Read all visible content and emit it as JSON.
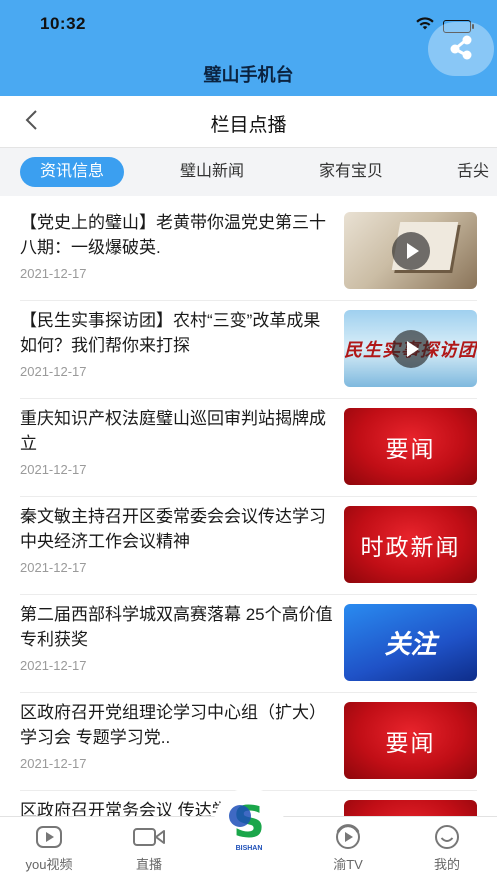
{
  "status_bar": {
    "time": "10:32"
  },
  "app": {
    "title": "璧山手机台"
  },
  "nav": {
    "title": "栏目点播"
  },
  "tabs": [
    {
      "label": "资讯信息",
      "active": true
    },
    {
      "label": "璧山新闻",
      "active": false
    },
    {
      "label": "家有宝贝",
      "active": false
    },
    {
      "label": "舌尖",
      "active": false
    }
  ],
  "news": [
    {
      "title": "【党史上的璧山】老黄带你温党史第三十八期：一级爆破英.",
      "date": "2021-12-17",
      "thumb": {
        "kind": "video",
        "style": "book",
        "text": ""
      }
    },
    {
      "title": "【民生实事探访团】农村“三变”改革成果如何？我们帮你来打探",
      "date": "2021-12-17",
      "thumb": {
        "kind": "video",
        "style": "sky",
        "text": "民生实事探访团"
      }
    },
    {
      "title": "重庆知识产权法庭璧山巡回审判站揭牌成立",
      "date": "2021-12-17",
      "thumb": {
        "kind": "image",
        "style": "red",
        "text": "要闻"
      }
    },
    {
      "title": "秦文敏主持召开区委常委会会议传达学习中央经济工作会议精神",
      "date": "2021-12-17",
      "thumb": {
        "kind": "image",
        "style": "red",
        "text": "时政新闻"
      }
    },
    {
      "title": "第二届西部科学城双高赛落幕 25个高价值专利获奖",
      "date": "2021-12-17",
      "thumb": {
        "kind": "image",
        "style": "blue",
        "text": "关注"
      }
    },
    {
      "title": "区政府召开党组理论学习中心组（扩大）学习会 专题学习党..",
      "date": "2021-12-17",
      "thumb": {
        "kind": "image",
        "style": "red",
        "text": "要闻"
      }
    },
    {
      "title": "区政府召开常务会议 传达学习中",
      "date": "",
      "thumb": {
        "kind": "image",
        "style": "red",
        "text": ""
      }
    }
  ],
  "tabbar": {
    "items": [
      {
        "label": "you视频",
        "icon": "play-circle-icon"
      },
      {
        "label": "直播",
        "icon": "video-camera-icon"
      },
      {
        "label": "渝TV",
        "icon": "tv-play-icon"
      },
      {
        "label": "我的",
        "icon": "smiley-icon"
      }
    ],
    "center_logo": {
      "text": "BISHAN",
      "icon": "bishan-logo-icon"
    }
  },
  "colors": {
    "header": "#4aa9f2",
    "tab_active": "#3b9ff0",
    "news_red": "#c10e16",
    "news_blue": "#1f52c7"
  }
}
